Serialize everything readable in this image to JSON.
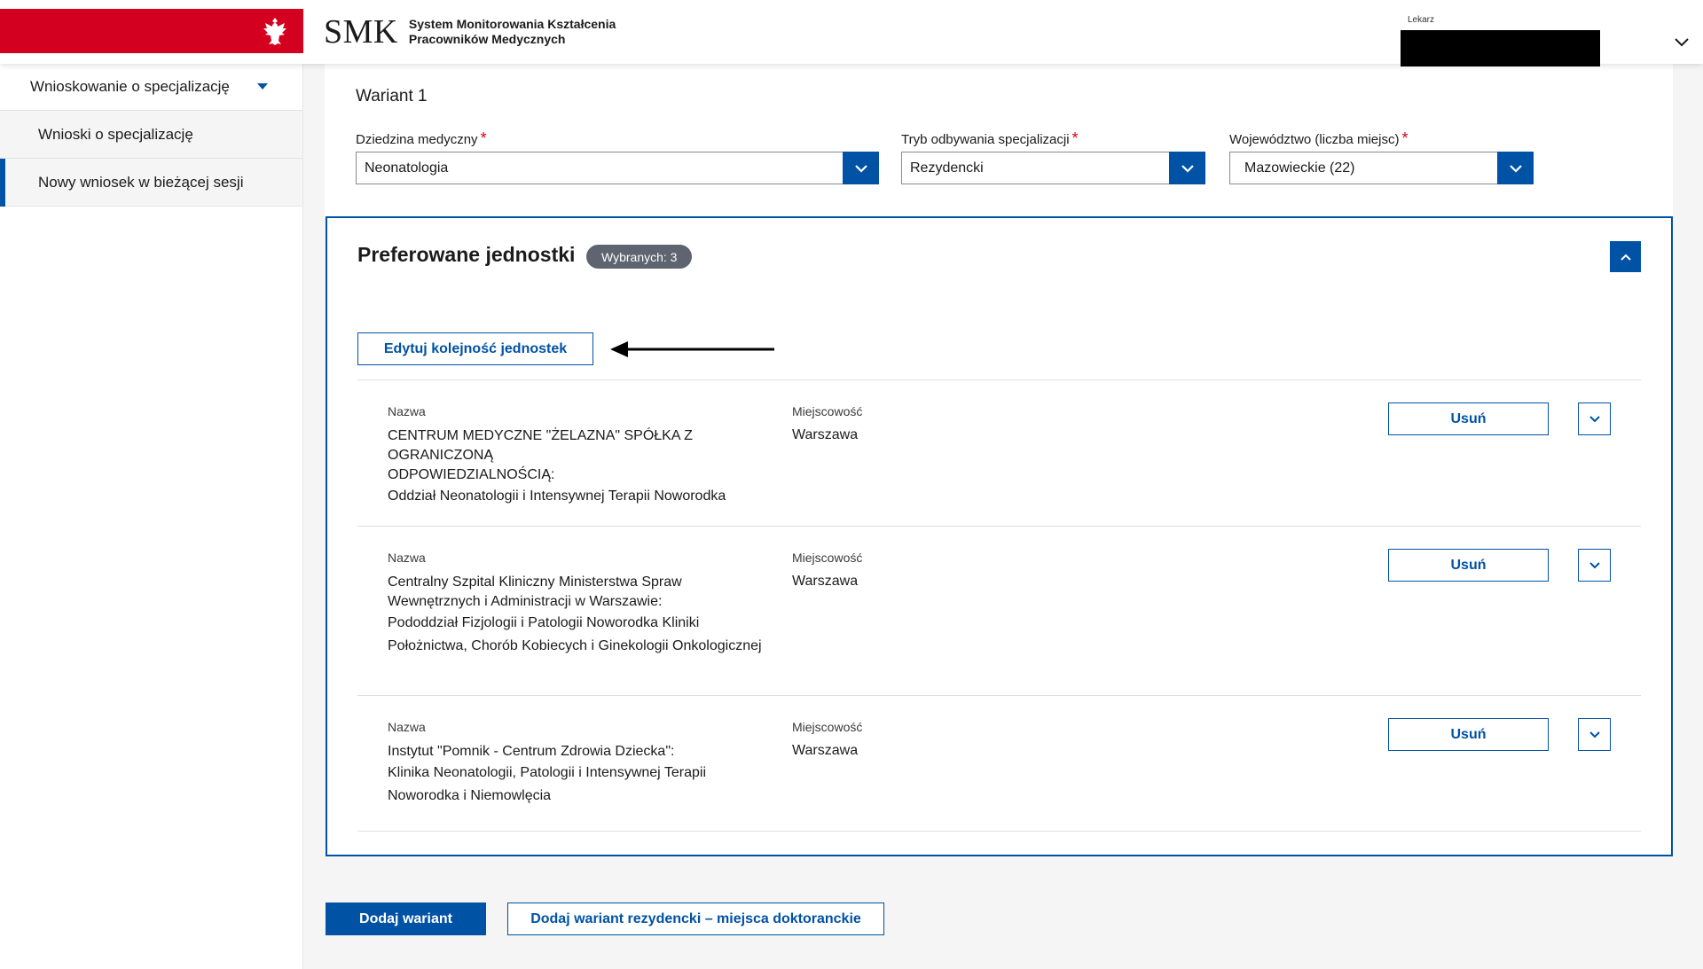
{
  "header": {
    "brand_short": "SMK",
    "brand_desc": "System Monitorowania Kształcenia Pracowników Medycznych",
    "user_role": "Lekarz"
  },
  "sidebar": {
    "parent_label": "Wnioskowanie o specjalizację",
    "items": [
      {
        "label": "Wnioski o specjalizację"
      },
      {
        "label": "Nowy wniosek w bieżącej sesji"
      }
    ]
  },
  "variant": {
    "title": "Wariant 1",
    "fields": [
      {
        "label": "Dziedzina medyczny",
        "value": "Neonatologia"
      },
      {
        "label": "Tryb odbywania specjalizacji",
        "value": "Rezydencki"
      },
      {
        "label": "Województwo (liczba miejsc)",
        "value": "Mazowieckie (22)"
      }
    ],
    "required_mark": "*"
  },
  "preferred": {
    "title": "Preferowane jednostki",
    "selected_badge": "Wybranych: 3",
    "edit_order_label": "Edytuj kolejność jednostek",
    "name_header": "Nazwa",
    "city_header": "Miejscowość",
    "remove_label": "Usuń",
    "units": [
      {
        "name_lines": [
          "CENTRUM MEDYCZNE \"ŻELAZNA\" SPÓŁKA Z OGRANICZONĄ",
          "ODPOWIEDZIALNOŚCIĄ:",
          "Oddział Neonatologii i Intensywnej Terapii Noworodka"
        ],
        "city": "Warszawa"
      },
      {
        "name_lines": [
          "Centralny Szpital Kliniczny Ministerstwa Spraw",
          "Wewnętrznych i Administracji w Warszawie:",
          "Pododdział Fizjologii i Patologii Noworodka Kliniki",
          "Położnictwa, Chorób Kobiecych i Ginekologii Onkologicznej"
        ],
        "city": "Warszawa"
      },
      {
        "name_lines": [
          "Instytut \"Pomnik - Centrum Zdrowia Dziecka\":",
          "Klinika Neonatologii, Patologii i Intensywnej Terapii",
          "Noworodka i Niemowlęcia"
        ],
        "city": "Warszawa"
      }
    ]
  },
  "actions": {
    "add_variant": "Dodaj wariant",
    "add_resident_doctoral": "Dodaj wariant rezydencki – miejsca doktoranckie"
  },
  "colors": {
    "accent": "#0052a5",
    "flag_red": "#d4001f",
    "badge_gray": "#5e6470"
  }
}
